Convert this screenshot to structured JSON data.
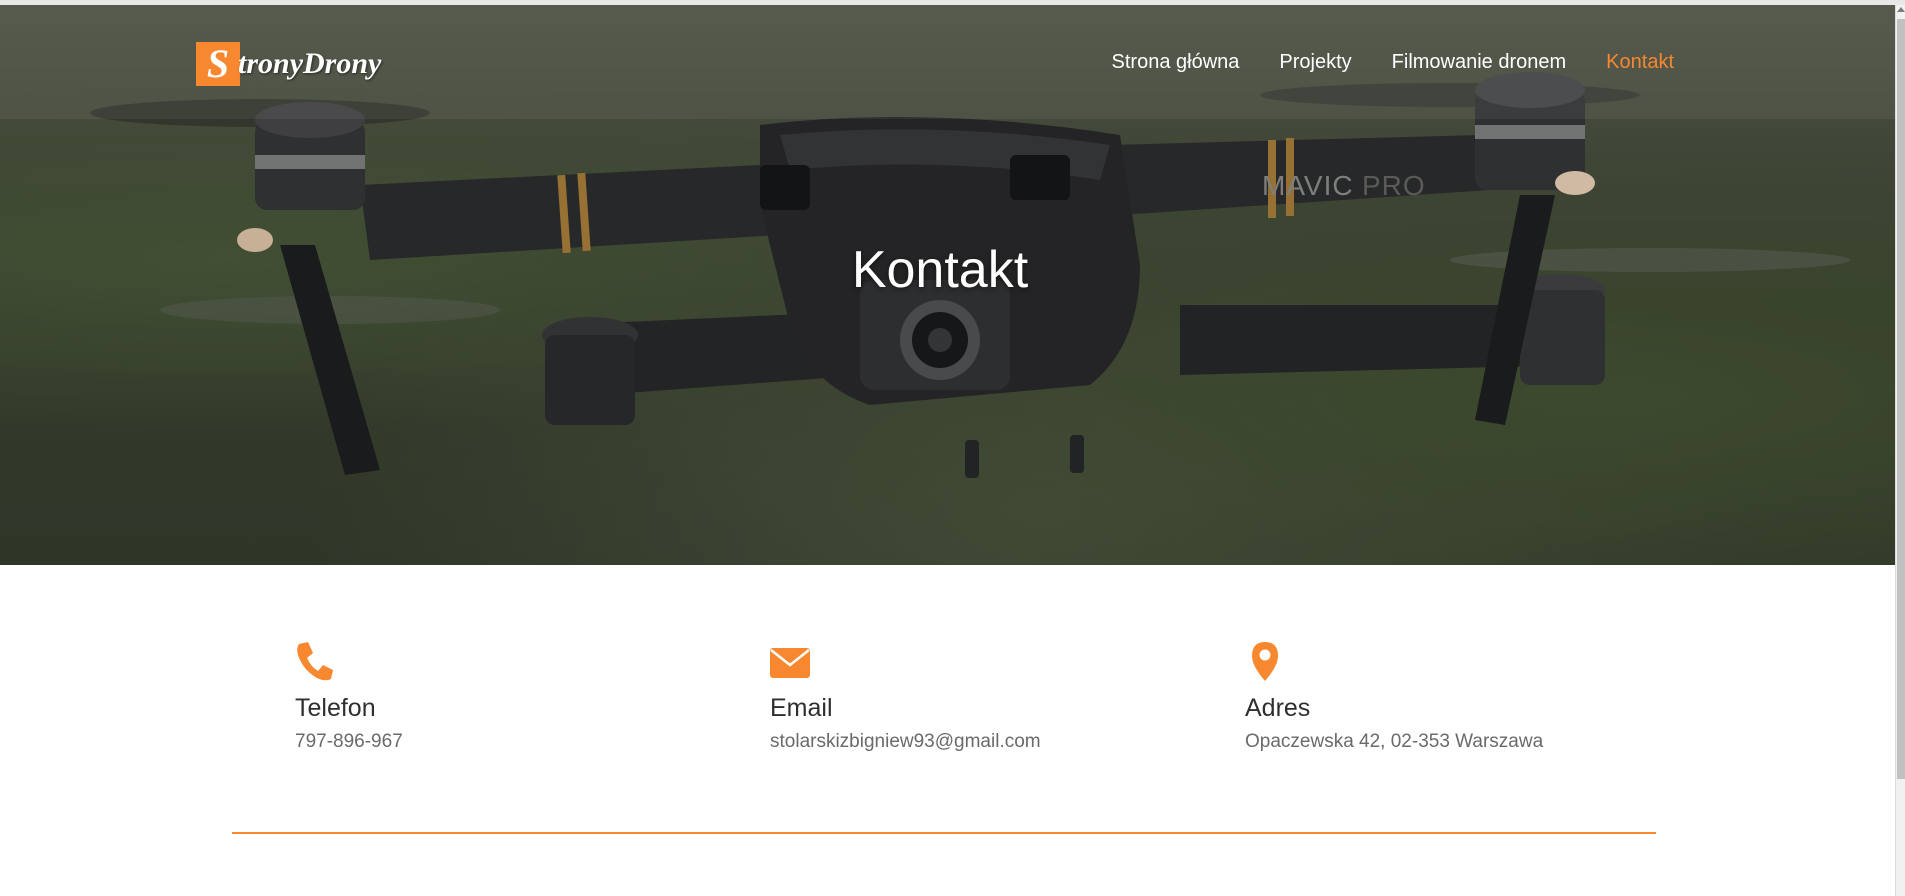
{
  "brand": {
    "logo_initial": "S",
    "logo_text": "tronyDrony",
    "accent_color": "#f7882f"
  },
  "nav": {
    "items": [
      {
        "label": "Strona główna"
      },
      {
        "label": "Projekty"
      },
      {
        "label": "Filmowanie dronem"
      },
      {
        "label": "Kontakt"
      }
    ],
    "active_item": "Kontakt"
  },
  "hero": {
    "title": "Kontakt",
    "image_text": "MAVICPRO"
  },
  "contact": {
    "items": [
      {
        "icon": "phone-icon",
        "title": "Telefon",
        "value": "797-896-967"
      },
      {
        "icon": "envelope-icon",
        "title": "Email",
        "value": "stolarskizbigniew93@gmail.com"
      },
      {
        "icon": "map-pin-icon",
        "title": "Adres",
        "value": "Opaczewska 42, 02-353 Warszawa"
      }
    ]
  }
}
